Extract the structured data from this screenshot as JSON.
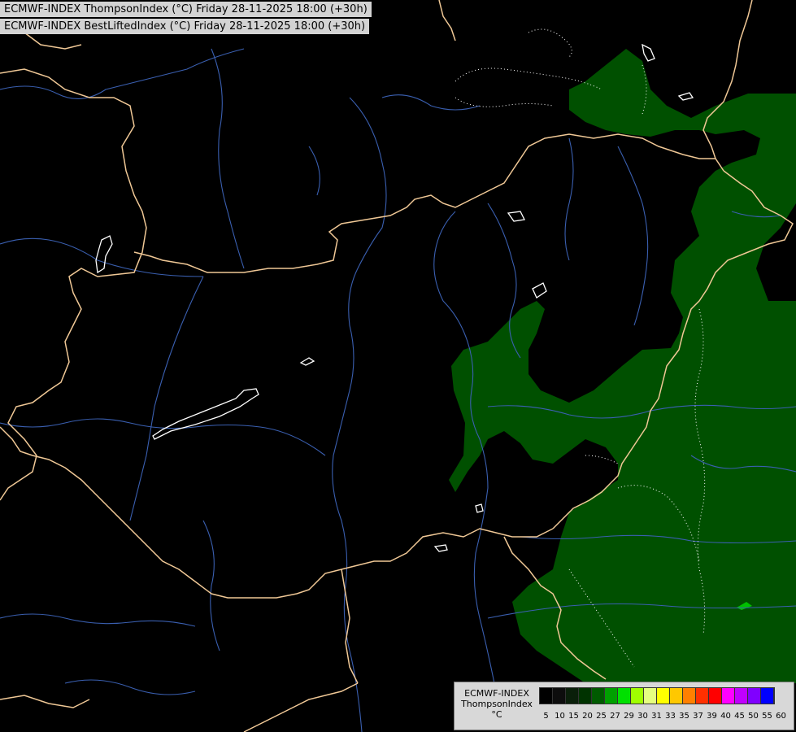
{
  "header": {
    "line1": "ECMWF-INDEX ThompsonIndex (°C) Friday 28-11-2025 18:00 (+30h)",
    "line2": "ECMWF-INDEX BestLiftedIndex (°C) Friday 28-11-2025 18:00 (+30h)"
  },
  "legend": {
    "title1": "ECMWF-INDEX",
    "title2": "ThompsonIndex",
    "unit": "°C",
    "ticks": [
      "5",
      "10",
      "15",
      "20",
      "25",
      "27",
      "29",
      "30",
      "31",
      "33",
      "35",
      "37",
      "39",
      "40",
      "45",
      "50",
      "55",
      "60"
    ],
    "colors": [
      "#000000",
      "#0d0d0d",
      "#0a1f0a",
      "#003300",
      "#005a00",
      "#00a000",
      "#00e000",
      "#a0ff00",
      "#e6ff80",
      "#ffff00",
      "#ffc800",
      "#ff8000",
      "#ff3000",
      "#ff0000",
      "#ff00ff",
      "#c000ff",
      "#8000ff",
      "#0000ff"
    ]
  },
  "colors": {
    "background": "#000000",
    "borders": "#f0c896",
    "rivers": "#3a5fb0",
    "field_green": "#005000",
    "lakes": "#ffffff"
  }
}
